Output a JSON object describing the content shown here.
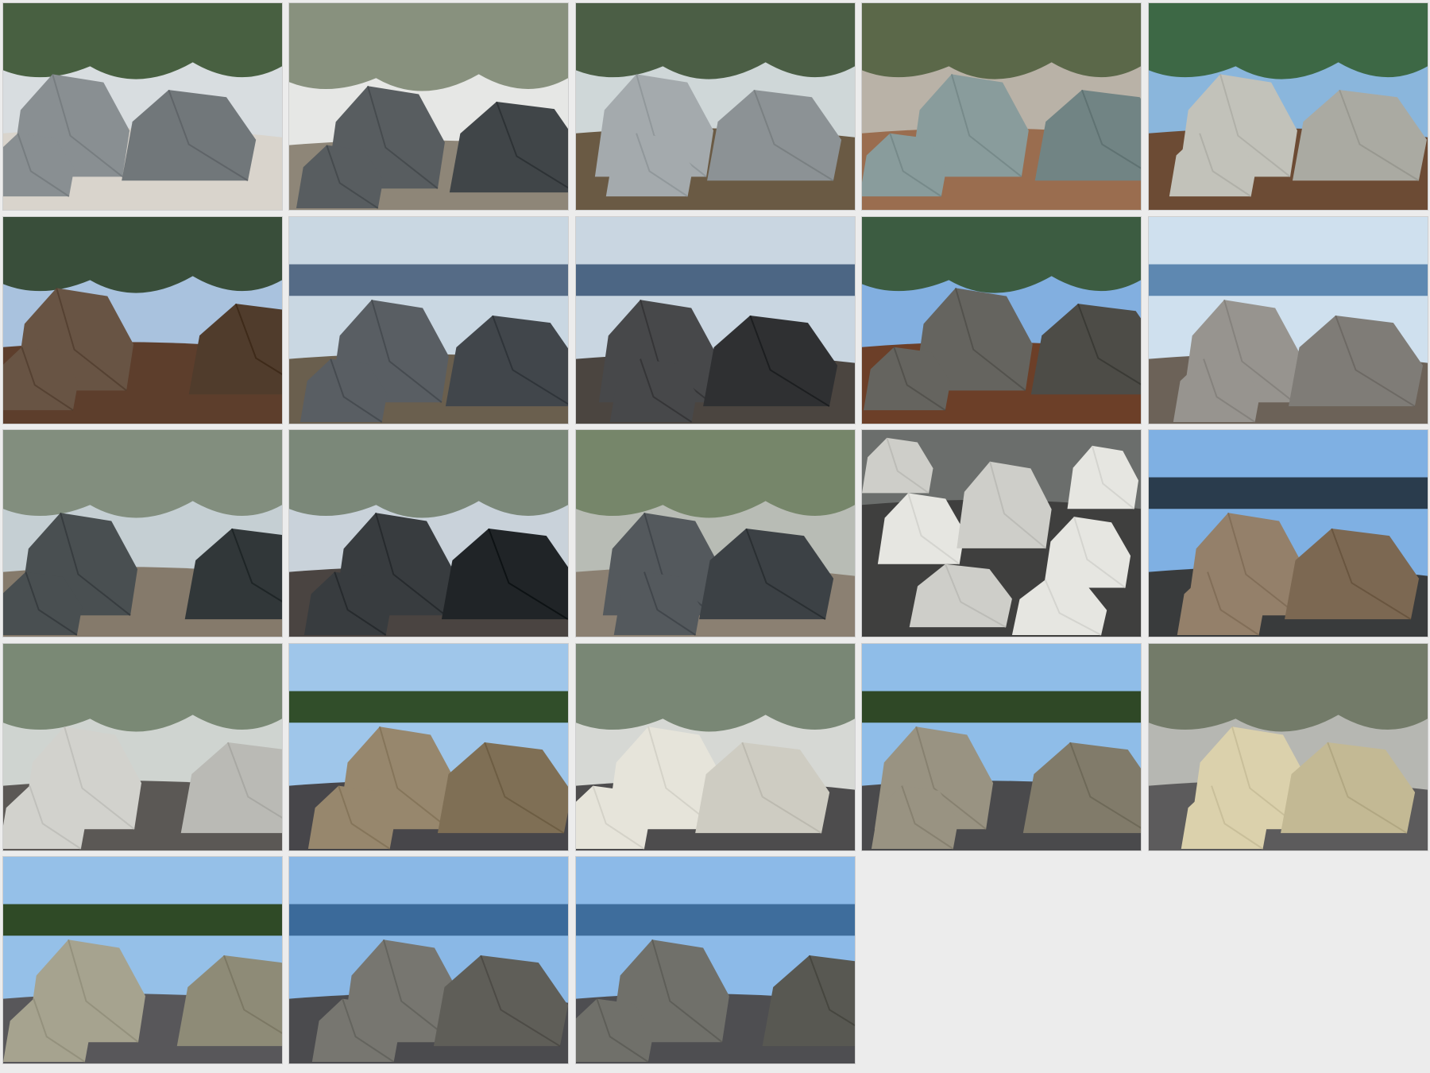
{
  "gallery": {
    "photos": [
      {
        "scene": "forest",
        "sky": "#d8dde0",
        "ground": "#d9d4cc",
        "rock": "#7f8588",
        "accent": "#2f4a25"
      },
      {
        "scene": "beach",
        "sky": "#e6e7e5",
        "ground": "#8e8678",
        "rock": "#4e5356",
        "accent": "#3a4a2a"
      },
      {
        "scene": "forest",
        "sky": "#cfd7d8",
        "ground": "#6a5a44",
        "rock": "#9aa0a3",
        "accent": "#34492b"
      },
      {
        "scene": "forest",
        "sky": "#b9b2a7",
        "ground": "#9a6d4f",
        "rock": "#7f9292",
        "accent": "#4a5a38"
      },
      {
        "scene": "forest",
        "sky": "#8ab6dc",
        "ground": "#6c4b34",
        "rock": "#b8b8b0",
        "accent": "#2f5a2a"
      },
      {
        "scene": "forest",
        "sky": "#a9c2de",
        "ground": "#5d3e2c",
        "rock": "#5e4a3a",
        "accent": "#263a1d"
      },
      {
        "scene": "sea",
        "sky": "#c9d7e2",
        "ground": "#6a5f4e",
        "rock": "#4f5459",
        "accent": "#556b86"
      },
      {
        "scene": "sea",
        "sky": "#c9d6e1",
        "ground": "#4b4540",
        "rock": "#3d3e40",
        "accent": "#4c6684"
      },
      {
        "scene": "forest",
        "sky": "#82afe0",
        "ground": "#6c3f28",
        "rock": "#5b5a55",
        "accent": "#304e24"
      },
      {
        "scene": "sea",
        "sky": "#cfe0ee",
        "ground": "#6c6258",
        "rock": "#8d8a85",
        "accent": "#5e88b1"
      },
      {
        "scene": "beach",
        "sky": "#c5cfd3",
        "ground": "#857a6b",
        "rock": "#3f4547",
        "accent": "#4a5a38"
      },
      {
        "scene": "beach",
        "sky": "#c9d2da",
        "ground": "#4a4441",
        "rock": "#2e3235",
        "accent": "#3a4a2a"
      },
      {
        "scene": "beach",
        "sky": "#b8bcb5",
        "ground": "#8b8072",
        "rock": "#4a4f53",
        "accent": "#3f5a2b"
      },
      {
        "scene": "boulders",
        "sky": "#6b6e6c",
        "ground": "#3f3f3e",
        "rock": "#dcdcd7",
        "accent": "#9ea0a0"
      },
      {
        "scene": "sea",
        "sky": "#7fb0e3",
        "ground": "#393b3c",
        "rock": "#8a7660",
        "accent": "#2a3c4d"
      },
      {
        "scene": "beach",
        "sky": "#cfd4d0",
        "ground": "#5b5855",
        "rock": "#c8c8c3",
        "accent": "#354a2a"
      },
      {
        "scene": "sea",
        "sky": "#9fc6ea",
        "ground": "#47464a",
        "rock": "#8d7d63",
        "accent": "#314e2a"
      },
      {
        "scene": "beach",
        "sky": "#d6d8d4",
        "ground": "#4d4c4d",
        "rock": "#dcdad0",
        "accent": "#2e4626"
      },
      {
        "scene": "sea",
        "sky": "#8fbde8",
        "ground": "#4a4a4c",
        "rock": "#8f8978",
        "accent": "#2f4826"
      },
      {
        "scene": "beach",
        "sky": "#b6b7b2",
        "ground": "#5c5b5c",
        "rock": "#d1c7a2",
        "accent": "#3c4a2e"
      },
      {
        "scene": "sea",
        "sky": "#95c0e8",
        "ground": "#58575a",
        "rock": "#9c9985",
        "accent": "#2f4a26"
      },
      {
        "scene": "sea",
        "sky": "#8ab8e6",
        "ground": "#4b4b4e",
        "rock": "#6d6c66",
        "accent": "#3b6a9a"
      },
      {
        "scene": "sea",
        "sky": "#8cbae8",
        "ground": "#4e4e51",
        "rock": "#666660",
        "accent": "#3e6d9c"
      }
    ]
  }
}
